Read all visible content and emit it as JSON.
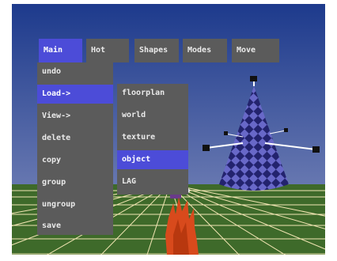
{
  "menubar": {
    "items": [
      {
        "label": "Main",
        "active": true
      },
      {
        "label": "Hot",
        "active": false
      },
      {
        "label": "Shapes",
        "active": false
      },
      {
        "label": "Modes",
        "active": false
      },
      {
        "label": "Move",
        "active": false
      }
    ]
  },
  "main_menu": {
    "items": [
      {
        "label": "undo",
        "highlighted": false
      },
      {
        "label": "Load->",
        "highlighted": true
      },
      {
        "label": "View->",
        "highlighted": false
      },
      {
        "label": "delete",
        "highlighted": false
      },
      {
        "label": "copy",
        "highlighted": false
      },
      {
        "label": "group",
        "highlighted": false
      },
      {
        "label": "ungroup",
        "highlighted": false
      },
      {
        "label": "save",
        "highlighted": false
      }
    ]
  },
  "load_submenu": {
    "items": [
      {
        "label": "floorplan",
        "highlighted": false
      },
      {
        "label": "world",
        "highlighted": false
      },
      {
        "label": "texture",
        "highlighted": false
      },
      {
        "label": "object",
        "highlighted": true
      },
      {
        "label": "LAG",
        "highlighted": false
      }
    ]
  },
  "colors": {
    "sky_top": "#1d3a8c",
    "sky_bottom": "#5f6fa8",
    "ground": "#3e6a2a",
    "grid_line": "#f3e6b4",
    "menu_bg": "#5b5b5b",
    "menu_highlight": "#4c4cd8",
    "menu_text": "#eaeaea",
    "cone_dark": "#23236e",
    "cone_light": "#6868c8",
    "flame": "#d84a1c",
    "red_piece": "#d81c2a"
  },
  "scene_objects": [
    "checkered-cone",
    "grid-floor",
    "orange-flame-object",
    "red-crystal-object"
  ]
}
